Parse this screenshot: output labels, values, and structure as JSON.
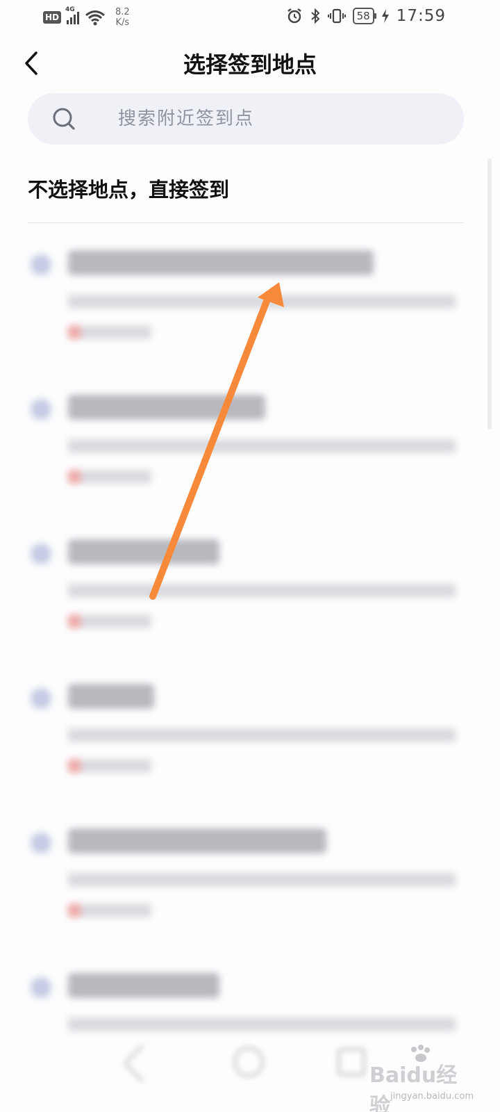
{
  "status_bar": {
    "hd": "HD",
    "network": "4G",
    "speed_value": "8.2",
    "speed_unit": "K/s",
    "battery": "58",
    "time": "17:59"
  },
  "header": {
    "title": "选择签到地点",
    "back_icon": "chevron-left-icon"
  },
  "search": {
    "placeholder": "搜索附近签到点",
    "value": "",
    "icon": "search-icon"
  },
  "options": {
    "no_location": "不选择地点，直接签到"
  },
  "location_list": {
    "item_count": 6,
    "items_blurred": true,
    "pin_color": "#c4cbe3",
    "distance_accent_color": "#f0a8a8"
  },
  "annotation": {
    "type": "arrow",
    "color": "#f68a3a"
  },
  "watermark": {
    "brand": "Baidu经验",
    "domain": "jingyan.baidu.com"
  }
}
